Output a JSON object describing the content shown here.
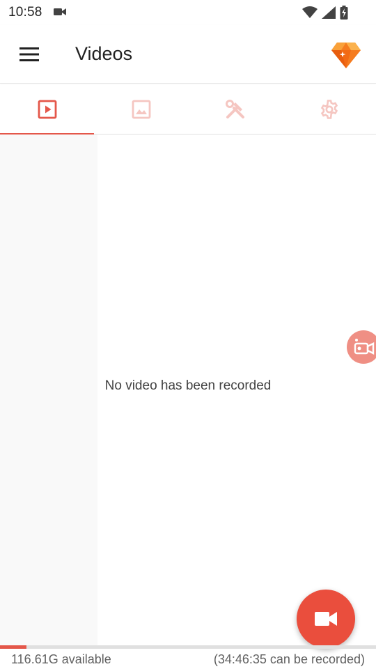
{
  "status_bar": {
    "time": "10:58",
    "icons": [
      "video-camera-icon",
      "wifi-icon",
      "cell-signal-icon",
      "battery-charging-icon"
    ]
  },
  "app_bar": {
    "title": "Videos",
    "menu_icon": "hamburger-menu-icon",
    "premium_icon": "diamond-icon"
  },
  "tabs": [
    {
      "icon": "play-video-icon",
      "active": true
    },
    {
      "icon": "image-icon",
      "active": false
    },
    {
      "icon": "tools-icon",
      "active": false
    },
    {
      "icon": "gear-icon",
      "active": false
    }
  ],
  "content": {
    "empty_message": "No video has been recorded"
  },
  "floating_recorder": {
    "icon": "camera-recorder-icon"
  },
  "fab": {
    "icon": "video-camera-icon"
  },
  "storage": {
    "available": "116.61G available",
    "recordable": "(34:46:35 can be recorded)",
    "used_fraction": 0.07
  },
  "colors": {
    "accent": "#e4574a",
    "fab": "#ea4e3d",
    "tab_inactive": "#f5c6c1",
    "floating_recorder": "#ef8f84",
    "premium_orange": "#f57c1f"
  }
}
